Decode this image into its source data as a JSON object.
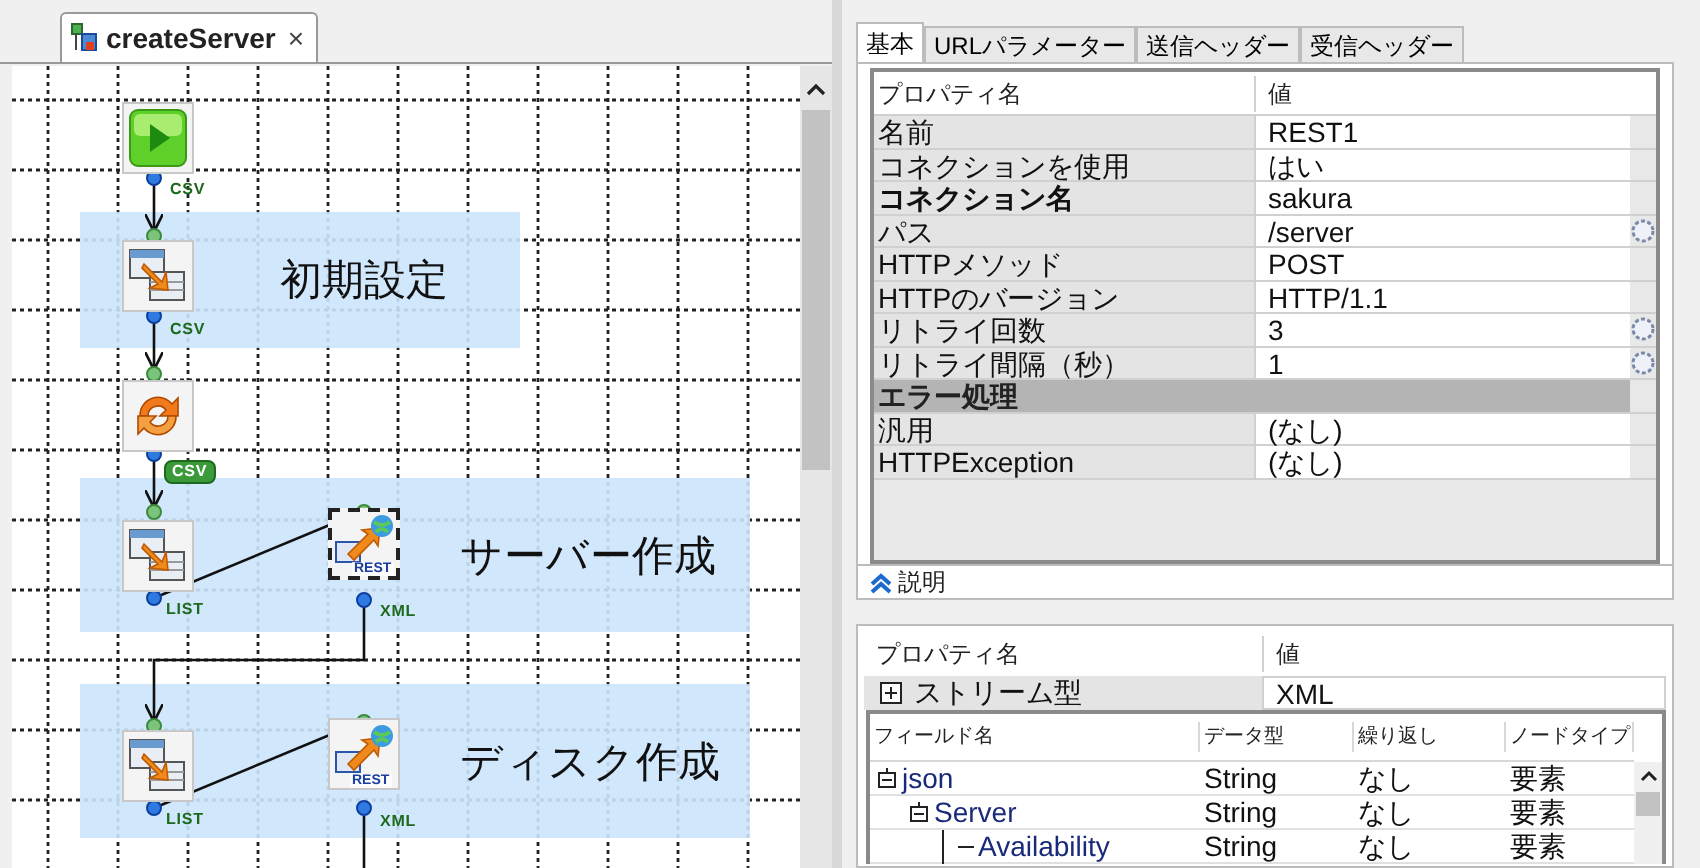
{
  "editor_tab": {
    "title": "createServer",
    "close": "×"
  },
  "canvas": {
    "groups": [
      {
        "label": "初期設定"
      },
      {
        "label": "サーバー作成"
      },
      {
        "label": "ディスク作成"
      }
    ],
    "nodes": [
      {
        "kind": "start",
        "selected": false
      },
      {
        "kind": "mapper",
        "selected": false
      },
      {
        "kind": "loop",
        "selected": false
      },
      {
        "kind": "mapper",
        "selected": false
      },
      {
        "kind": "rest",
        "label": "REST",
        "selected": true
      },
      {
        "kind": "mapper",
        "selected": false
      },
      {
        "kind": "rest",
        "label": "REST",
        "selected": false
      }
    ],
    "port_labels": [
      {
        "text": "CSV",
        "kind": "plain"
      },
      {
        "text": "CSV",
        "kind": "plain"
      },
      {
        "text": "CSV",
        "kind": "tag"
      },
      {
        "text": "LIST",
        "kind": "plain"
      },
      {
        "text": "XML",
        "kind": "plain"
      },
      {
        "text": "LIST",
        "kind": "plain"
      },
      {
        "text": "XML",
        "kind": "plain"
      }
    ]
  },
  "property_tabs": [
    {
      "label": "基本",
      "selected": true
    },
    {
      "label": "URLパラメーター",
      "selected": false
    },
    {
      "label": "送信ヘッダー",
      "selected": false
    },
    {
      "label": "受信ヘッダー",
      "selected": false
    }
  ],
  "properties": {
    "columns": [
      "プロパティ名",
      "値"
    ],
    "rows": [
      {
        "kind": "prop",
        "name": "名前",
        "value": "REST1",
        "bold": false,
        "has_button": false
      },
      {
        "kind": "prop",
        "name": "コネクションを使用",
        "value": "はい",
        "bold": false,
        "has_button": false
      },
      {
        "kind": "prop",
        "name": "コネクション名",
        "value": "sakura",
        "bold": true,
        "has_button": false
      },
      {
        "kind": "prop",
        "name": "パス",
        "value": "/server",
        "bold": false,
        "has_button": true
      },
      {
        "kind": "prop",
        "name": "HTTPメソッド",
        "value": "POST",
        "bold": false,
        "has_button": false
      },
      {
        "kind": "prop",
        "name": "HTTPのバージョン",
        "value": "HTTP/1.1",
        "bold": false,
        "has_button": false
      },
      {
        "kind": "prop",
        "name": "リトライ回数",
        "value": "3",
        "bold": false,
        "has_button": true
      },
      {
        "kind": "prop",
        "name": "リトライ間隔（秒）",
        "value": "1",
        "bold": false,
        "has_button": true
      },
      {
        "kind": "category",
        "name": "エラー処理"
      },
      {
        "kind": "prop",
        "name": "汎用",
        "value": "(なし)",
        "bold": false,
        "has_button": false
      },
      {
        "kind": "prop",
        "name": "HTTPException",
        "value": "(なし)",
        "bold": false,
        "has_button": false
      }
    ]
  },
  "description": {
    "label": "説明"
  },
  "stream_properties": {
    "columns": [
      "プロパティ名",
      "値"
    ],
    "rows": [
      {
        "name": "ストリーム型",
        "value": "XML",
        "expanded": false
      }
    ]
  },
  "fields": {
    "columns": [
      "フィールド名",
      "データ型",
      "繰り返し",
      "ノードタイプ"
    ],
    "rows": [
      {
        "name": "json",
        "type": "String",
        "repeat": "なし",
        "node_type": "要素",
        "expanded": true,
        "children": [
          {
            "name": "Server",
            "type": "String",
            "repeat": "なし",
            "node_type": "要素",
            "expanded": true,
            "children": [
              {
                "name": "Availability",
                "type": "String",
                "repeat": "なし",
                "node_type": "要素"
              }
            ]
          }
        ]
      }
    ]
  }
}
